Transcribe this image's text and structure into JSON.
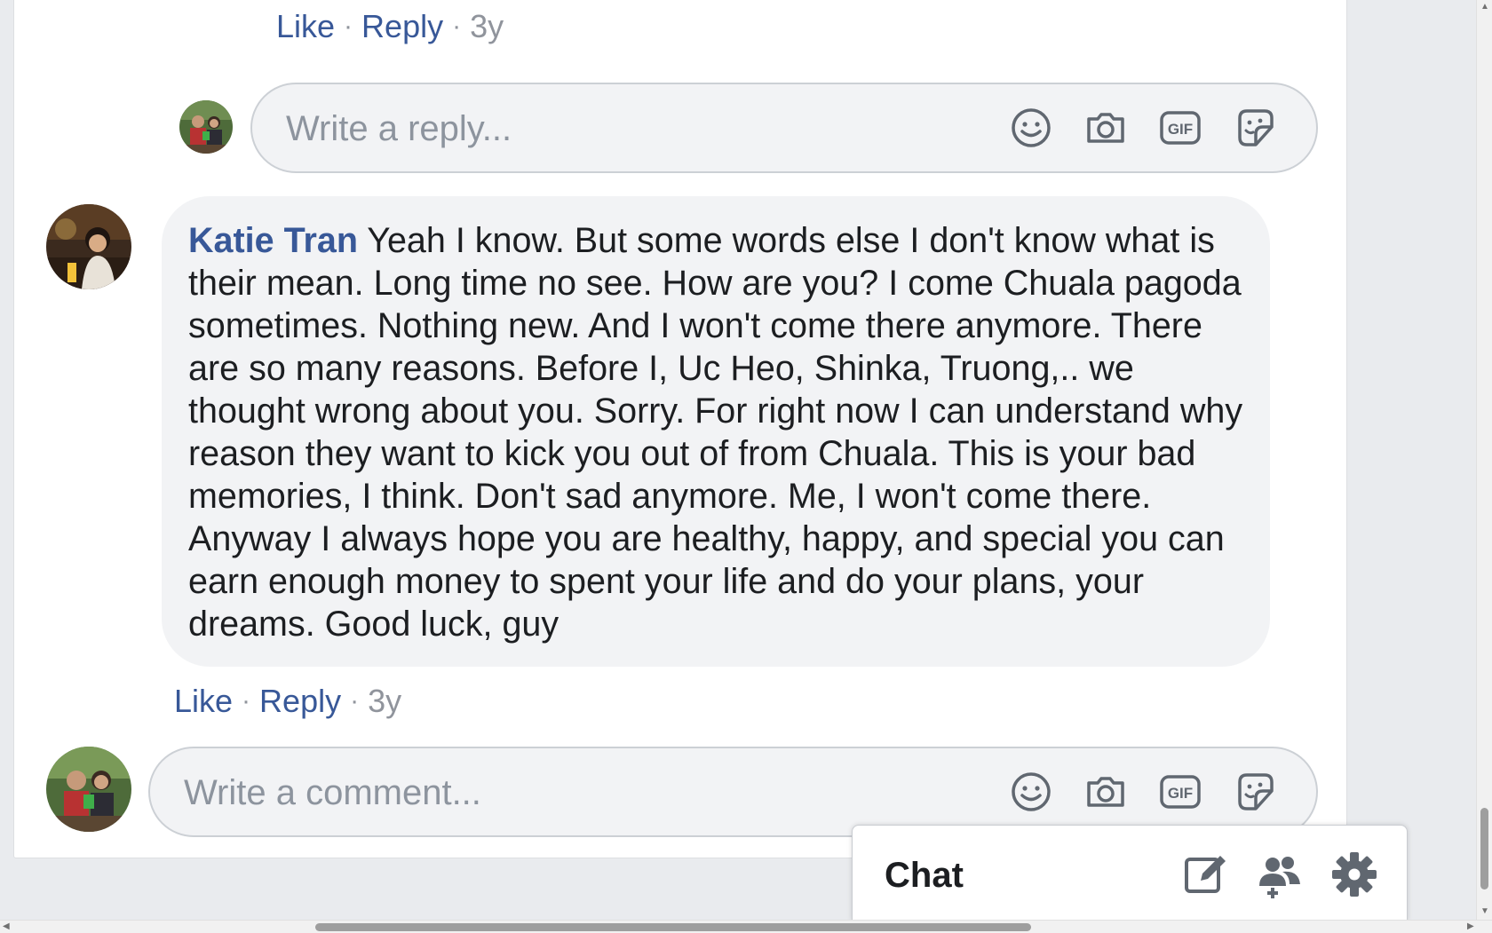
{
  "top_reply_meta": {
    "like": "Like",
    "reply": "Reply",
    "separator": "·",
    "age": "3y"
  },
  "reply_input": {
    "placeholder": "Write a reply..."
  },
  "comment": {
    "author": "Katie Tran",
    "text": " Yeah I know. But some words else I don't know what is their mean. Long time no see. How are you? I come Chuala pagoda sometimes. Nothing new. And I won't come there anymore. There are so many reasons. Before I, Uc Heo, Shinka, Truong,.. we thought wrong about you. Sorry. For right now I can understand why reason they want to kick you out of from Chuala. This is your bad memories, I think. Don't sad anymore. Me, I won't come there. Anyway I always hope you are healthy, happy, and special you can earn enough money to spent your life and do your plans, your dreams. Good luck, guy"
  },
  "comment_meta": {
    "like": "Like",
    "reply": "Reply",
    "separator": "·",
    "age": "3y"
  },
  "comment_input": {
    "placeholder": "Write a comment..."
  },
  "input_tools": [
    "emoji-icon",
    "camera-icon",
    "gif-icon",
    "sticker-icon"
  ],
  "chat": {
    "title": "Chat",
    "icons": [
      "compose-icon",
      "create-group-icon",
      "settings-gear-icon"
    ]
  },
  "colors": {
    "link": "#385898",
    "bubble": "#f2f3f5",
    "page_bg": "#e9ebee",
    "icon": "#606770"
  }
}
